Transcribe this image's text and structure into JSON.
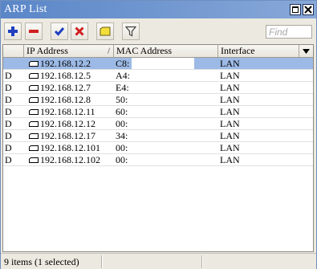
{
  "window": {
    "title": "ARP List"
  },
  "toolbar": {
    "buttons": [
      {
        "name": "add",
        "icon": "plus-icon",
        "color": "#1f3fbf"
      },
      {
        "name": "remove",
        "icon": "minus-icon",
        "color": "#d02020"
      },
      {
        "name": "enable",
        "icon": "checkmark-icon",
        "color": "#1f3fbf"
      },
      {
        "name": "disable",
        "icon": "x-icon",
        "color": "#d02020"
      },
      {
        "name": "comment",
        "icon": "note-icon",
        "color": "#f2df3a"
      },
      {
        "name": "filter",
        "icon": "filter-icon",
        "color": "#555555"
      }
    ],
    "find_placeholder": "Find"
  },
  "table": {
    "columns": [
      "",
      "IP Address",
      "MAC Address",
      "Interface"
    ],
    "sort_indicator": "/",
    "rows": [
      {
        "flag": "",
        "ip": "192.168.12.2",
        "mac": "C8:",
        "interface": "LAN",
        "selected": true
      },
      {
        "flag": "D",
        "ip": "192.168.12.5",
        "mac": "A4:",
        "interface": "LAN",
        "selected": false
      },
      {
        "flag": "D",
        "ip": "192.168.12.7",
        "mac": "E4:",
        "interface": "LAN",
        "selected": false
      },
      {
        "flag": "D",
        "ip": "192.168.12.8",
        "mac": "50:",
        "interface": "LAN",
        "selected": false
      },
      {
        "flag": "D",
        "ip": "192.168.12.11",
        "mac": "60:",
        "interface": "LAN",
        "selected": false
      },
      {
        "flag": "D",
        "ip": "192.168.12.12",
        "mac": "00:",
        "interface": "LAN",
        "selected": false
      },
      {
        "flag": "D",
        "ip": "192.168.12.17",
        "mac": "34:",
        "interface": "LAN",
        "selected": false
      },
      {
        "flag": "D",
        "ip": "192.168.12.101",
        "mac": "00:",
        "interface": "LAN",
        "selected": false
      },
      {
        "flag": "D",
        "ip": "192.168.12.102",
        "mac": "00:",
        "interface": "LAN",
        "selected": false
      }
    ]
  },
  "status": {
    "text": "9 items (1 selected)"
  },
  "colors": {
    "titlebar": "#5a86c8",
    "selected_row": "#9dbae6"
  }
}
